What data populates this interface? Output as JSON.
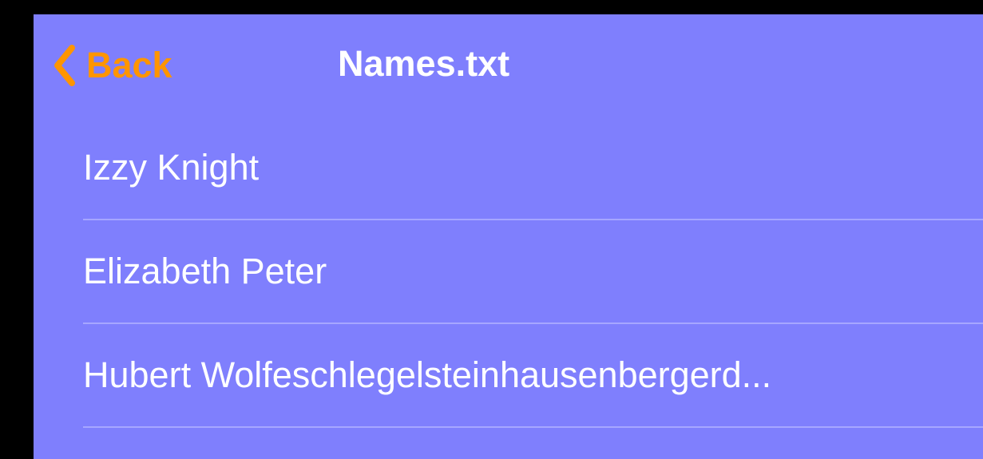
{
  "colors": {
    "outer_background": "#000000",
    "screen_background": "#7f7ffd",
    "back_accent": "#ff9500",
    "title_text": "#ffffff",
    "row_text": "#ffffff",
    "divider": "#a6a6ff"
  },
  "nav": {
    "back_icon": "chevron-left-icon",
    "back_label": "Back",
    "title": "Names.txt"
  },
  "list": {
    "rows": [
      {
        "text": "Izzy Knight"
      },
      {
        "text": "Elizabeth Peter"
      },
      {
        "text": "Hubert Wolfeschlegelsteinhausenbergerd..."
      }
    ]
  }
}
